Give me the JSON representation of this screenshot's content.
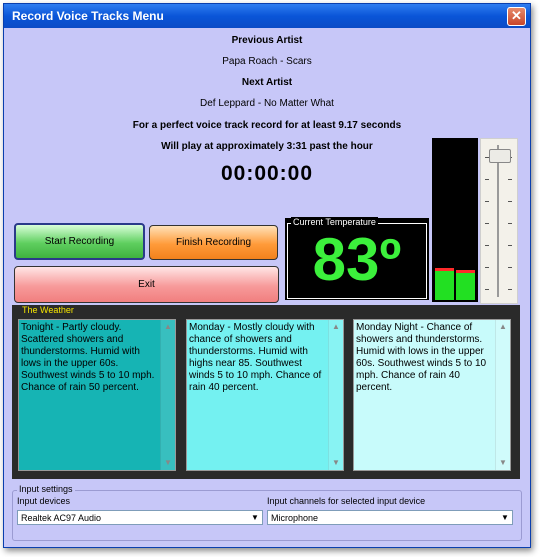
{
  "window": {
    "title": "Record Voice Tracks Menu",
    "close_glyph": "✕"
  },
  "info": {
    "previous_label": "Previous Artist",
    "previous_value": "Papa Roach - Scars",
    "next_label": "Next Artist",
    "next_value": "Def Leppard - No Matter What",
    "record_hint": "For a perfect voice track record for at least 9.17 seconds",
    "play_hint": "Will play at approximately 3:31 past the hour",
    "timer": "00:00:00"
  },
  "buttons": {
    "start": "Start Recording",
    "finish": "Finish Recording",
    "exit": "Exit"
  },
  "temperature": {
    "legend": "Current Temperature",
    "value": "83º"
  },
  "vu_meter": {
    "left_level": 0.18,
    "right_level": 0.17
  },
  "volume_slider": {
    "level": 0.95
  },
  "weather": {
    "legend": "The Weather",
    "boxes": [
      {
        "text": "Tonight - Partly cloudy. Scattered showers and thunderstorms. Humid with lows in the upper 60s. Southwest winds 5 to 10 mph. Chance of rain 50 percent.",
        "color": "#16b4b4"
      },
      {
        "text": "Monday - Mostly cloudy with chance of showers and thunderstorms. Humid with highs near 85. Southwest winds 5 to 10 mph. Chance of rain 40 percent.",
        "color": "#74f1f1"
      },
      {
        "text": "Monday Night - Chance of showers and thunderstorms. Humid with lows in the upper 60s. Southwest winds 5 to 10 mph. Chance of rain 40 percent.",
        "color": "#c8fbfb"
      }
    ]
  },
  "input_settings": {
    "legend": "Input settings",
    "devices_label": "Input devices",
    "devices_value": "Realtek AC97 Audio",
    "channels_label": "Input channels for selected input device",
    "channels_value": "Microphone"
  },
  "colors": {
    "window_bg": "#c7c7f8",
    "temp_digits": "#3cf03c",
    "weather_legend": "#f5e500"
  }
}
